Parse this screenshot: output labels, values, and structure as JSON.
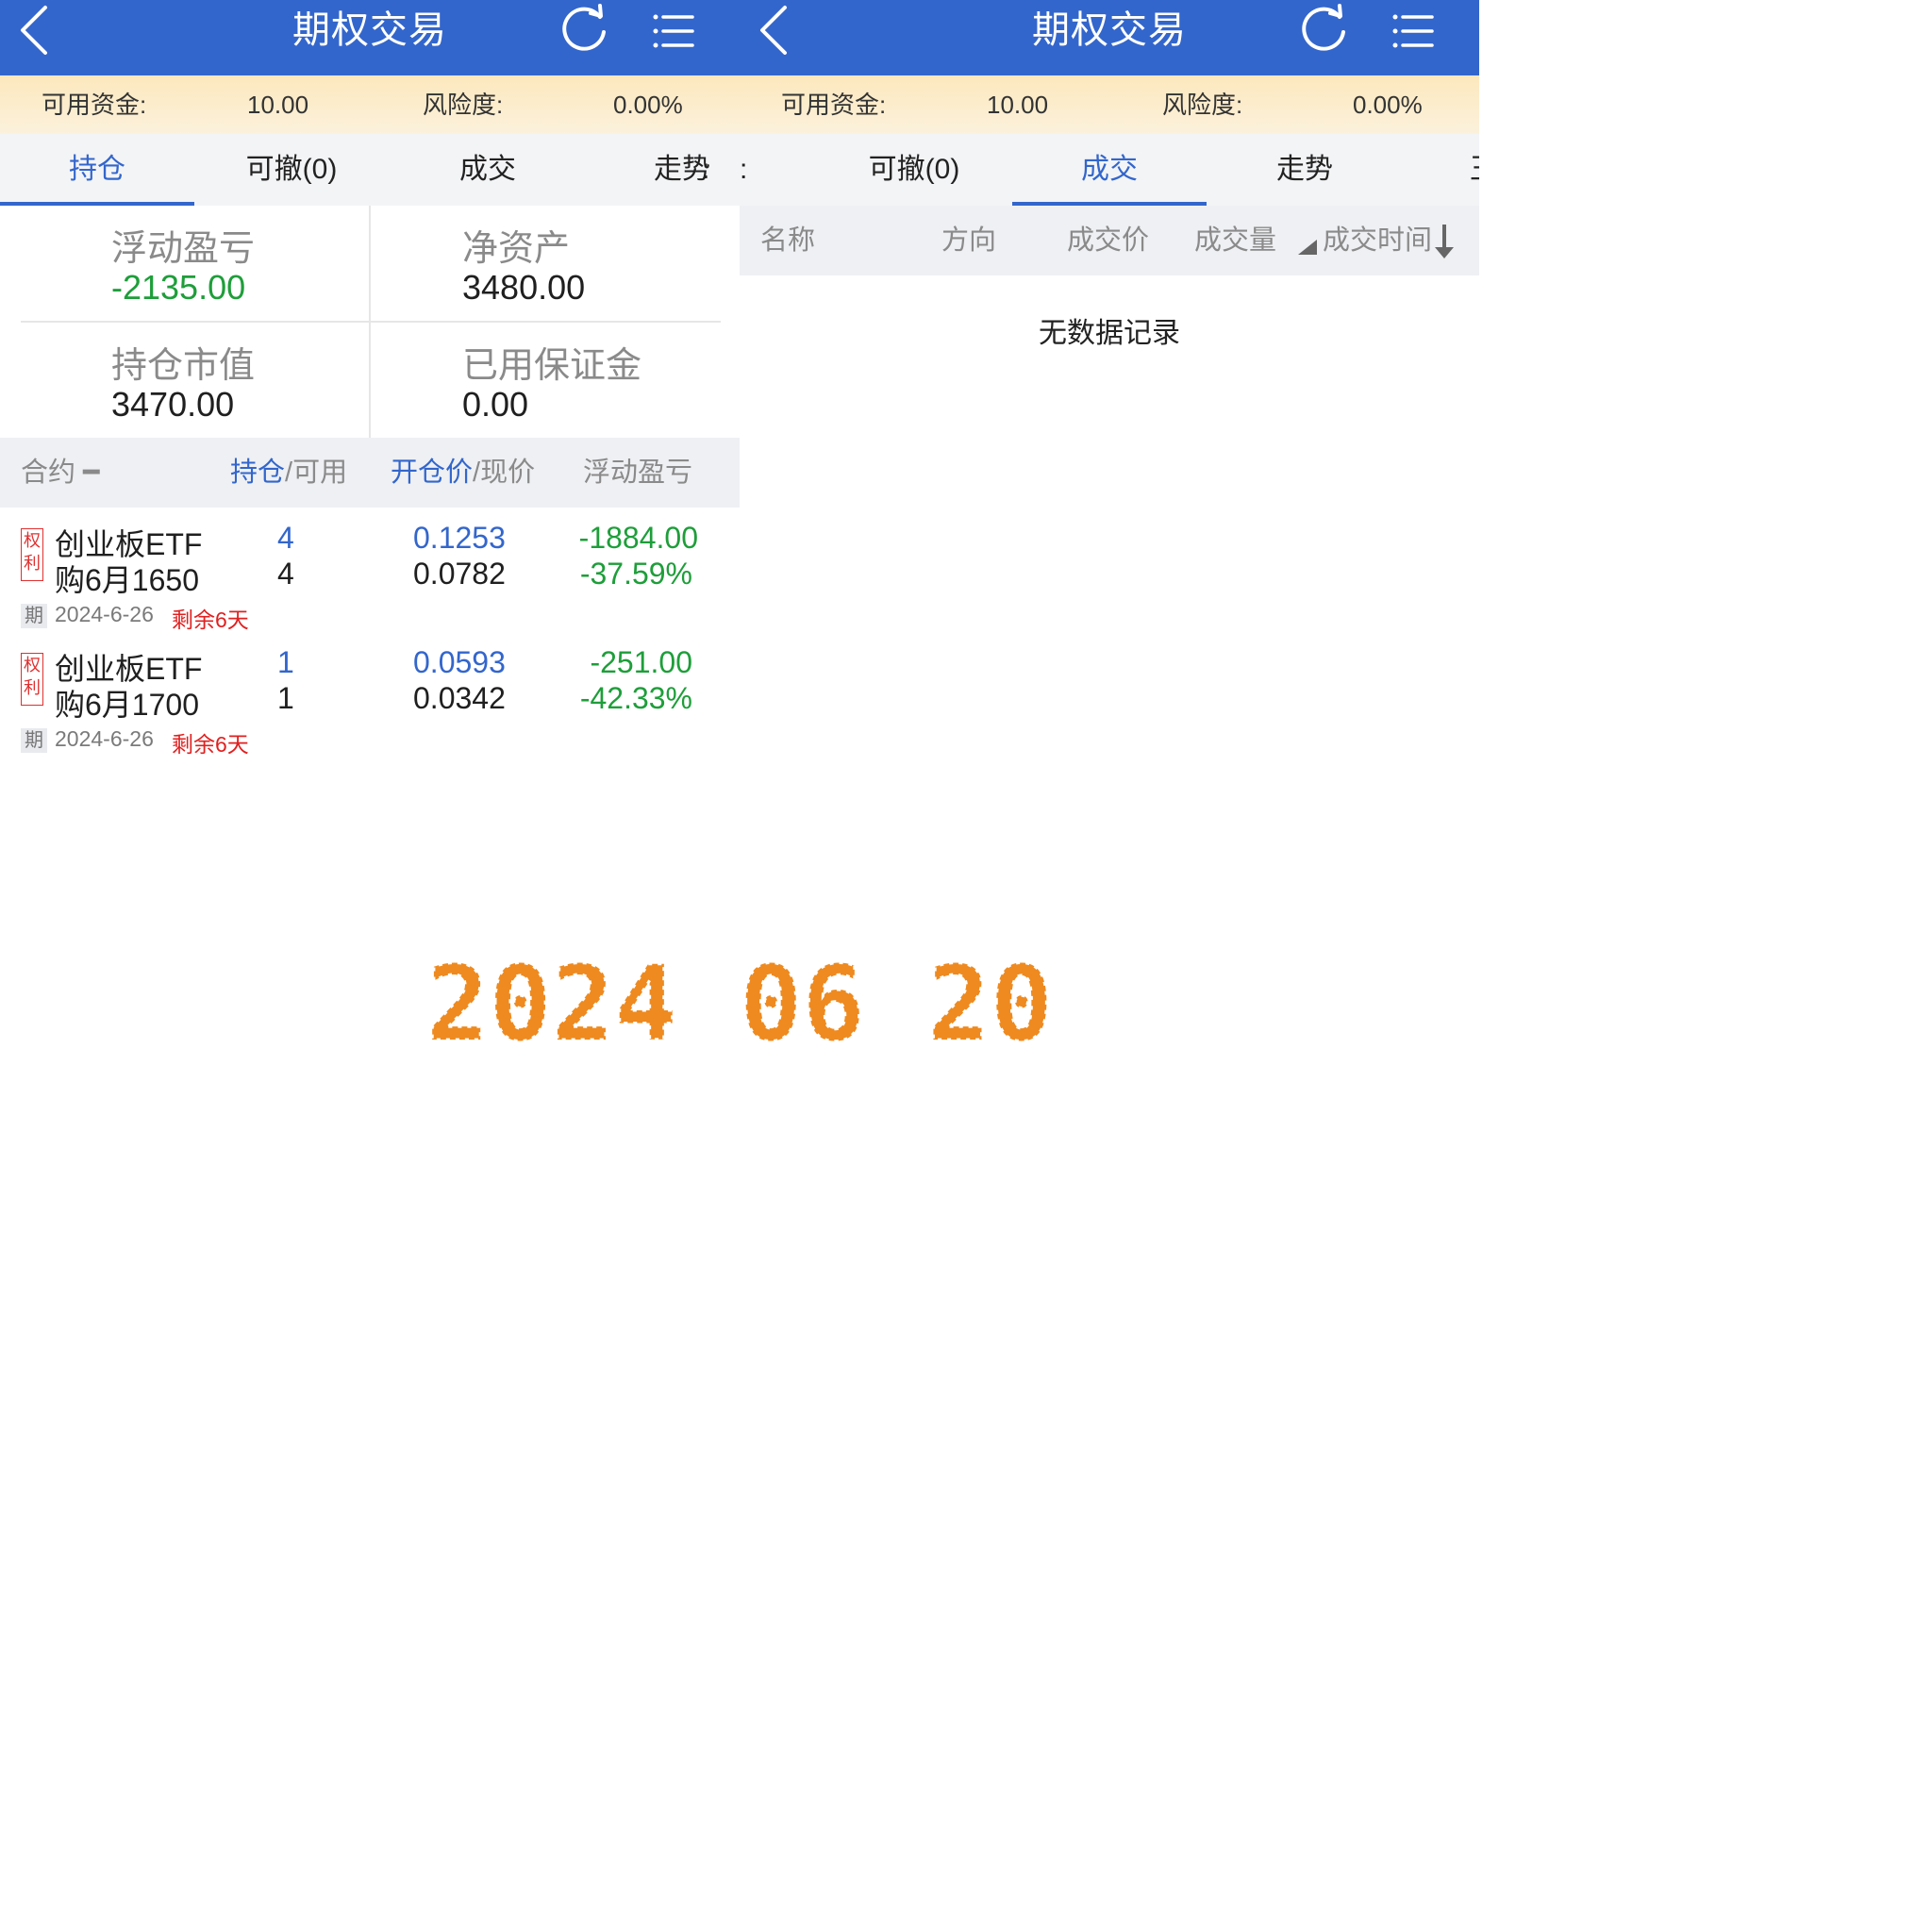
{
  "left": {
    "title": "期权交易",
    "fund_label": "可用资金:",
    "fund_value": "10.00",
    "risk_label": "风险度:",
    "risk_value": "0.00%",
    "tabs": [
      "持仓",
      "可撤(0)",
      "成交",
      "走势"
    ],
    "tab_edge": ":",
    "summary": {
      "float_pl_label": "浮动盈亏",
      "float_pl_value": "-2135.00",
      "net_asset_label": "净资产",
      "net_asset_value": "3480.00",
      "position_value_label": "持仓市值",
      "position_value_value": "3470.00",
      "margin_label": "已用保证金",
      "margin_value": "0.00"
    },
    "table_header": {
      "contract": "合约",
      "holding": "持仓",
      "available": "/可用",
      "open_price": "开仓价",
      "cur_price": "/现价",
      "float_pl": "浮动盈亏"
    },
    "rows": [
      {
        "badge": "权利",
        "name_line1": "创业板ETF",
        "name_line2": "购6月1650",
        "holding": "4",
        "available": "4",
        "open_price": "0.1253",
        "cur_price": "0.0782",
        "pl": "-1884.00",
        "pl_pct": "-37.59%",
        "expiry_badge": "期",
        "expiry_date": "2024-6-26",
        "remaining": "剩余6天"
      },
      {
        "badge": "权利",
        "name_line1": "创业板ETF",
        "name_line2": "购6月1700",
        "holding": "1",
        "available": "1",
        "open_price": "0.0593",
        "cur_price": "0.0342",
        "pl": "-251.00",
        "pl_pct": "-42.33%",
        "expiry_badge": "期",
        "expiry_date": "2024-6-26",
        "remaining": "剩余6天"
      }
    ]
  },
  "right": {
    "title": "期权交易",
    "fund_label": "可用资金:",
    "fund_value": "10.00",
    "risk_label": "风险度:",
    "risk_value": "0.00%",
    "tabs": [
      "可撤(0)",
      "成交",
      "走势"
    ],
    "tab_edge_left": ":",
    "tab_edge_right": "王",
    "columns": [
      "名称",
      "方向",
      "成交价",
      "成交量",
      "成交时间"
    ],
    "empty_message": "无数据记录"
  },
  "date_stamp": "2024 06 20",
  "colors": {
    "brand_blue": "#3366cc",
    "gain_green": "#1e9e3a",
    "alert_red": "#e02020",
    "stamp_orange": "#ee8a1f"
  },
  "icons": [
    "back-chevron-icon",
    "refresh-icon",
    "list-menu-icon",
    "sort-down-arrow-icon",
    "sort-triangle-icon"
  ]
}
